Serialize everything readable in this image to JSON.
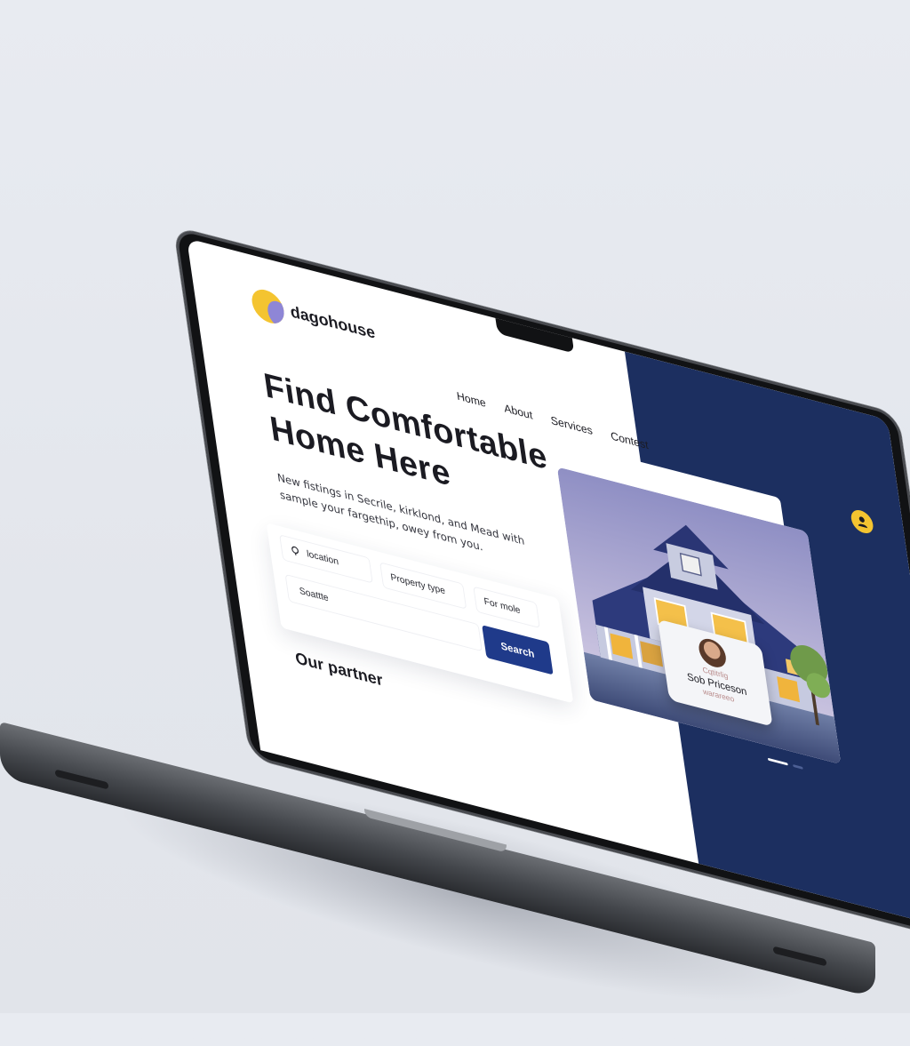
{
  "brand": {
    "name": "dagohouse"
  },
  "nav": {
    "items": [
      "Home",
      "About",
      "Services",
      "Contest"
    ]
  },
  "hero": {
    "title_line1": "Find Comfortable",
    "title_line2": "Home Here",
    "subtitle": "New fistings in Secrile, kirklond, and Mead with sample your fargethip, owey from you."
  },
  "search": {
    "location_label": "location",
    "property_type_label": "Property type",
    "sale_label": "For mole",
    "input_value": "Soattte",
    "button_label": "Search"
  },
  "partners": {
    "title": "Our partner"
  },
  "agent": {
    "subtitle": "Cqtitrlig",
    "name": "Sob Priceson",
    "tag": "warareeo"
  },
  "icons": {
    "logo": "dagohouse-logo-icon",
    "user": "user-icon",
    "location": "map-pin-icon"
  },
  "colors": {
    "accent": "#f4c430",
    "primary": "#1f3a8a",
    "panel": "#1c2f60"
  }
}
